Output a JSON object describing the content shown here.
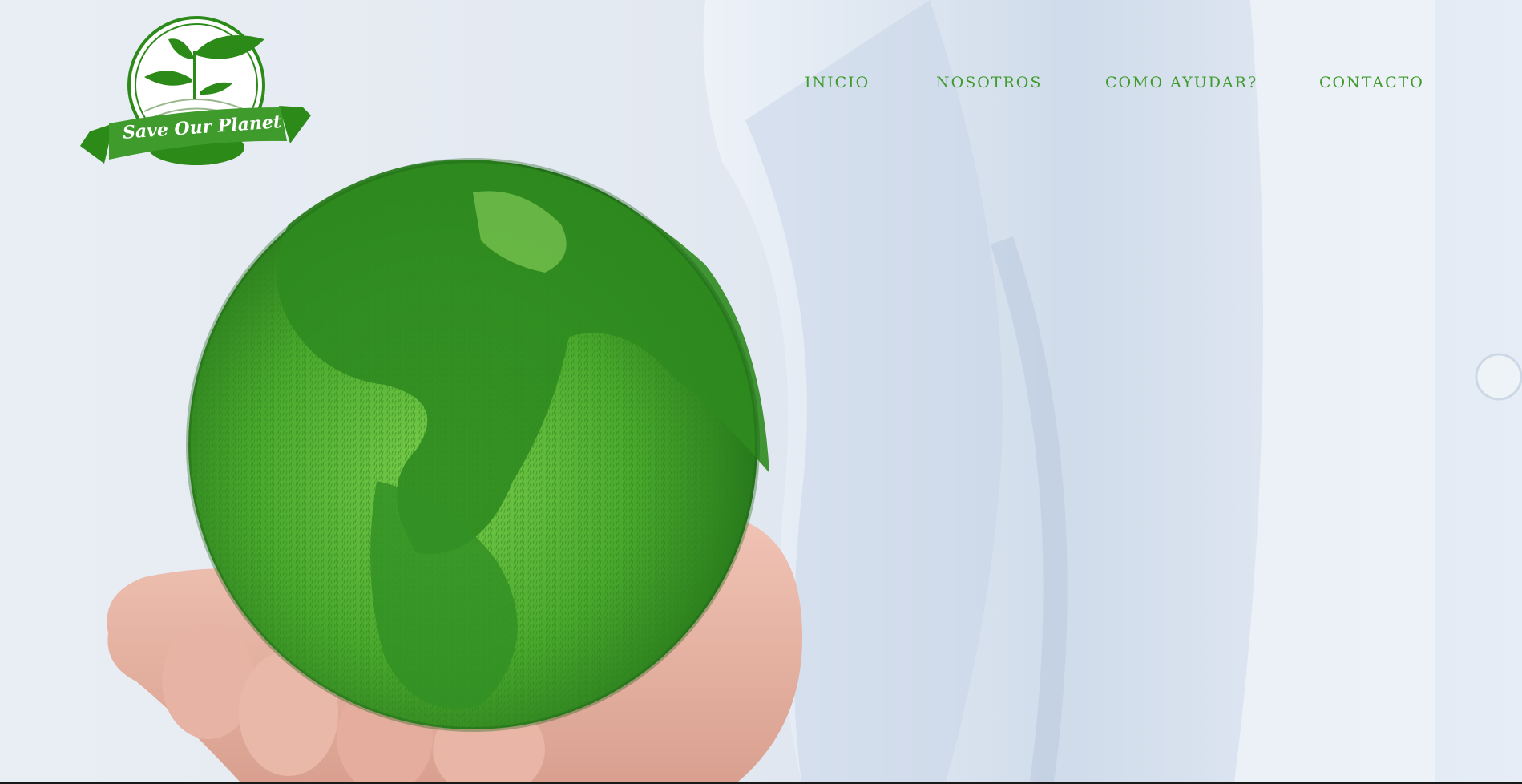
{
  "brand": {
    "logo_text": "Save Our Planet",
    "primary_color": "#3f9b2c",
    "dark_green": "#2c8a18"
  },
  "nav": {
    "items": [
      {
        "label": "INICIO"
      },
      {
        "label": "NOSOTROS"
      },
      {
        "label": "COMO AYUDAR?"
      },
      {
        "label": "CONTACTO"
      }
    ]
  },
  "hero": {
    "image": "grass-globe-in-hand"
  }
}
